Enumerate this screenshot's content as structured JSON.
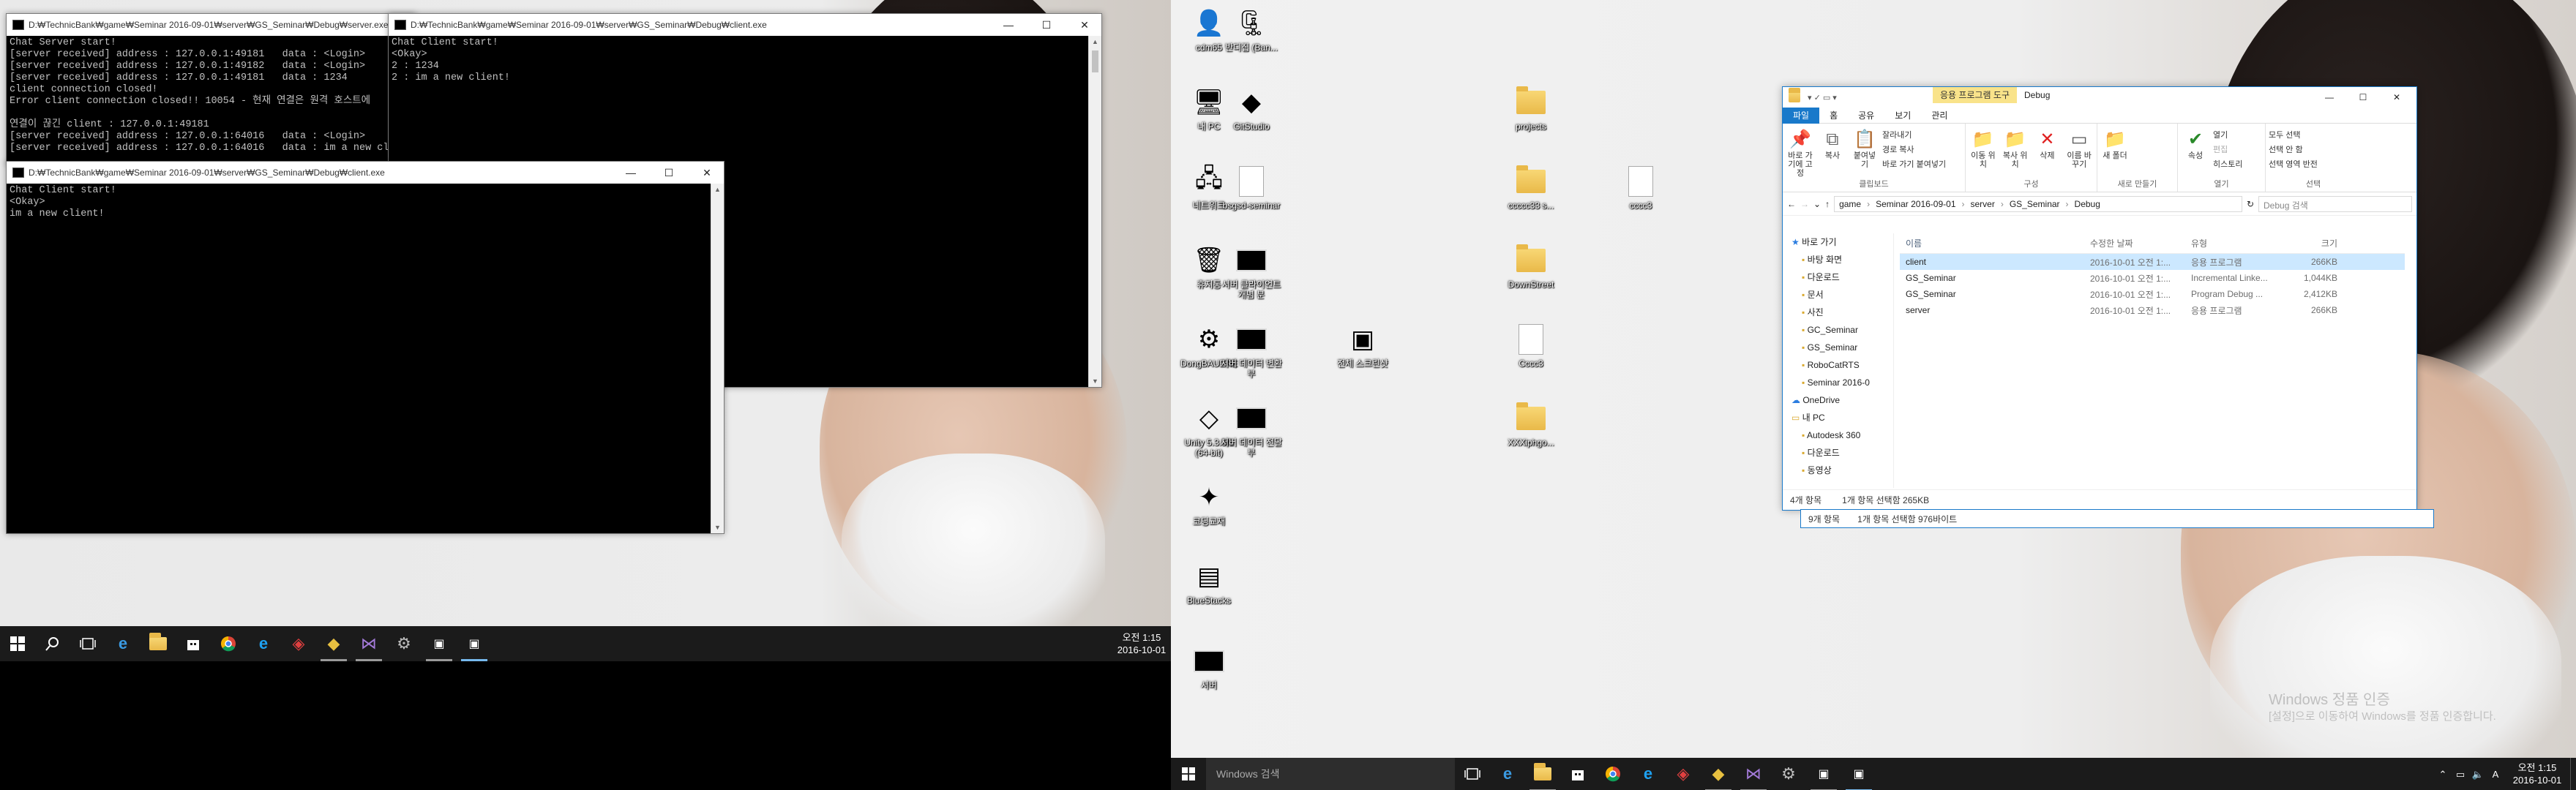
{
  "server_console": {
    "title": "D:₩TechnicBank₩game₩Seminar 2016-09-01₩server₩GS_Seminar₩Debug₩server.exe",
    "lines": [
      "Chat Server start!",
      "[server received] address : 127.0.0.1:49181   data : <Login>",
      "[server received] address : 127.0.0.1:49182   data : <Login>",
      "[server received] address : 127.0.0.1:49181   data : 1234",
      "client connection closed!",
      "Error client connection closed!! 10054 - 현재 연결은 원격 호스트에",
      "",
      "연결이 끊긴 client : 127.0.0.1:49181",
      "[server received] address : 127.0.0.1:64016   data : <Login>",
      "[server received] address : 127.0.0.1:64016   data : im a new cl"
    ]
  },
  "client_console_1": {
    "title": "D:₩TechnicBank₩game₩Seminar 2016-09-01₩server₩GS_Seminar₩Debug₩client.exe",
    "lines": [
      "Chat Client start!",
      "<Okay>",
      "2 : 1234",
      "2 : im a new client!"
    ]
  },
  "client_console_2": {
    "title": "D:₩TechnicBank₩game₩Seminar 2016-09-01₩server₩GS_Seminar₩Debug₩client.exe",
    "lines": [
      "Chat Client start!",
      "<Okay>",
      "im a new client!"
    ]
  },
  "window_controls": {
    "minimize": "—",
    "maximize": "☐",
    "close": "✕"
  },
  "taskbar_left": {
    "clock_time": "오전 1:15",
    "clock_date": "2016-10-01"
  },
  "taskbar_right": {
    "search_placeholder": "Windows 검색",
    "clock_time": "오전 1:15",
    "clock_date": "2016-10-01"
  },
  "desktop_icons": [
    {
      "label": "cdm65",
      "icon": "user-icon"
    },
    {
      "label": "반디집 (Ban...",
      "icon": "zip-icon"
    },
    {
      "label": "내 PC",
      "icon": "pc-icon"
    },
    {
      "label": "GitStudio",
      "icon": "git-icon"
    },
    {
      "label": "네트워크",
      "icon": "network-icon"
    },
    {
      "label": "bsgsd-seminar",
      "icon": "document-icon"
    },
    {
      "label": "휴지통",
      "icon": "recycle-bin-icon"
    },
    {
      "label": "서버 클라이언트 개념 분",
      "icon": "console-icon"
    },
    {
      "label": "DongBAUERE",
      "icon": "settings-icon"
    },
    {
      "label": "서버 데이터 변환 부",
      "icon": "console-icon"
    },
    {
      "label": "Unity 5.3.5f1 (64-bit)",
      "icon": "unity-icon"
    },
    {
      "label": "서버 데이터 전달 부",
      "icon": "console-icon"
    },
    {
      "label": "코딩교재",
      "icon": "coding-icon"
    },
    {
      "label": "BlueStacks",
      "icon": "bluestacks-icon"
    },
    {
      "label": "서버",
      "icon": "console-icon"
    },
    {
      "label": "전체 스크린샷",
      "icon": "screenshot-icon"
    },
    {
      "label": "projects",
      "icon": "folder-icon"
    },
    {
      "label": "ccccc33 s...",
      "icon": "folder-icon"
    },
    {
      "label": "cccc3",
      "icon": "document-icon"
    },
    {
      "label": "DownStreet",
      "icon": "folder-icon"
    },
    {
      "label": "Cccc3",
      "icon": "document-icon"
    },
    {
      "label": "XXXiphgo...",
      "icon": "folder-icon"
    }
  ],
  "explorer": {
    "context_tab": "응용 프로그램 도구",
    "title": "Debug",
    "tabs": [
      "파일",
      "홈",
      "공유",
      "보기",
      "관리"
    ],
    "ribbon": {
      "pin": "바로 가기에 고정",
      "copy": "복사",
      "paste": "붙여넣기",
      "cut": "잘라내기",
      "copy_path": "경로 복사",
      "paste_shortcut": "바로 가기 붙여넣기",
      "clipboard_group": "클립보드",
      "move_to": "이동 위치",
      "copy_to": "복사 위치",
      "delete": "삭제",
      "rename": "이름 바꾸기",
      "organize_group": "구성",
      "new_folder": "새 폴더",
      "new_group": "새로 만들기",
      "properties": "속성",
      "open": "열기",
      "edit": "편집",
      "history": "히스토리",
      "open_group": "열기",
      "select_all": "모두 선택",
      "select_none": "선택 안 함",
      "invert": "선택 영역 반전",
      "select_group": "선택"
    },
    "breadcrumb": [
      "game",
      "Seminar 2016-09-01",
      "server",
      "GS_Seminar",
      "Debug"
    ],
    "search_placeholder": "Debug 검색",
    "columns": [
      "이름",
      "수정한 날짜",
      "유형",
      "크기"
    ],
    "files": [
      {
        "name": "client",
        "date": "2016-10-01 오전 1:...",
        "type": "응용 프로그램",
        "size": "266KB",
        "selected": true
      },
      {
        "name": "GS_Seminar",
        "date": "2016-10-01 오전 1:...",
        "type": "Incremental Linke...",
        "size": "1,044KB",
        "selected": false
      },
      {
        "name": "GS_Seminar",
        "date": "2016-10-01 오전 1:...",
        "type": "Program Debug ...",
        "size": "2,412KB",
        "selected": false
      },
      {
        "name": "server",
        "date": "2016-10-01 오전 1:...",
        "type": "응용 프로그램",
        "size": "266KB",
        "selected": false
      }
    ],
    "nav": [
      "바로 가기",
      "바탕 화면",
      "다운로드",
      "문서",
      "사진",
      "GC_Seminar",
      "GS_Seminar",
      "RoboCatRTS",
      "Seminar 2016-0",
      "OneDrive",
      "내 PC",
      "Autodesk 360",
      "다운로드",
      "동영상"
    ],
    "status_count": "4개 항목",
    "status_selected": "1개 항목 선택함 265KB",
    "status2_count": "9개 항목",
    "status2_selected": "1개 항목 선택함 976바이트"
  },
  "watermark": {
    "line1": "Windows 정품 인증",
    "line2": "[설정]으로 이동하여 Windows를 정품 인증합니다."
  },
  "colors": {
    "accent": "#1979ca",
    "context_tab": "#f9e38a",
    "taskbar": "#1b1b1b",
    "selected_row": "#cce8ff"
  }
}
